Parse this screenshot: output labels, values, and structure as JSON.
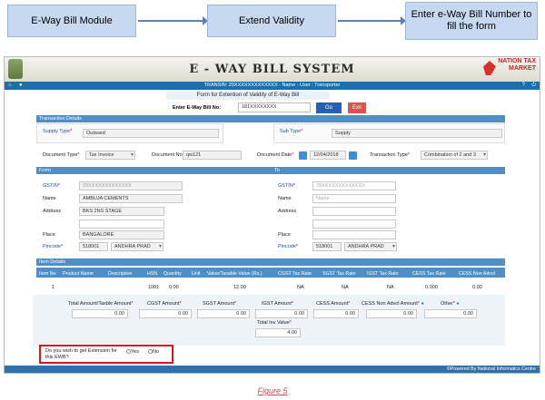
{
  "flow": {
    "step1": "E-Way Bill Module",
    "step2": "Extend Validity",
    "step3": "Enter e-Way Bill Number to fill the form"
  },
  "header": {
    "title": "E - WAY BILL SYSTEM",
    "logo_text": "NATION TAX MARKET",
    "nav_info": "TRANSIN: 29XXXXXXXXXXXXX - Name - User : Transporter"
  },
  "form": {
    "title": "Form for Extention of Validity of E-Way Bill",
    "ewb_label": "Enter E-Way Bill No:",
    "ewb_value": "181XXXXXXXX",
    "go": "Go",
    "exit": "Exit"
  },
  "transaction": {
    "section": "Transaction Details",
    "supply_type_label": "Supply Type",
    "supply_type": "Outward",
    "sub_type_label": "Sub Type",
    "sub_type": "Supply",
    "doc_type_label": "Document Type",
    "doc_type": "Tax Invoice",
    "doc_no_label": "Document No",
    "doc_no": "qw121",
    "doc_date_label": "Document Date",
    "doc_date": "12/04/2018",
    "txn_type_label": "Transaction Type",
    "txn_type": "Combination of 2 and 3"
  },
  "from": {
    "section": "From",
    "gstin_label": "GSTIN",
    "gstin": "29XXXXXXXXXXXXX",
    "name_label": "Name",
    "name": "AMBUJA CEMENTS",
    "address_label": "Address",
    "address1": "BKS 2NS STAGE",
    "address2": "",
    "place_label": "Place",
    "place": "BANGALORE",
    "pincode_label": "Pincode",
    "pincode": "518001",
    "state": "ANDHRA PRAD"
  },
  "to": {
    "section": "To",
    "gstin_label": "GSTIN",
    "gstin": "29XXXXXXXXXXXXX",
    "name_label": "Name",
    "name": "Name",
    "address_label": "Address",
    "place_label": "Place",
    "pincode_label": "Pincode",
    "pincode": "518001",
    "state": "ANDHRA PRAD"
  },
  "items": {
    "section": "Item Details",
    "headers": [
      "Item No",
      "Product Name",
      "Description",
      "HSN",
      "Quantity",
      "Unit",
      "Value/Taxable Value (Rs.)",
      "CGST Tax Rate",
      "SGST Tax Rate",
      "IGST Tax Rate",
      "CESS Tax Rate",
      "CESS Non Advol"
    ],
    "row": [
      "1",
      "",
      "",
      "1001",
      "0.00",
      "",
      "12.00",
      "NA",
      "NA",
      "NA",
      "0.000",
      "0.00"
    ]
  },
  "totals": {
    "total_amount_label": "Total Amount/Taxble Amount",
    "total_amount": "0.00",
    "cgst_label": "CGST Amount",
    "cgst": "0.00",
    "sgst_label": "SGST Amount",
    "sgst": "0.00",
    "igst_label": "IGST Amount",
    "igst": "0.00",
    "cess_label": "CESS Amount",
    "cess": "0.00",
    "cess_nonadvol_label": "CESS Non Advol Amount",
    "cess_nonadvol": "0.00",
    "other_label": "Other",
    "other": "0.00",
    "total_inv_label": "Total Inv Value",
    "total_inv": "4.00"
  },
  "extension": {
    "question": "Do you wish to get Extension for this EWB?",
    "yes": "Yes",
    "no": "No"
  },
  "footer": {
    "powered": "©Powered By National Informatics Centre"
  },
  "caption": "Figure 5",
  "colors": {
    "step_fill": "#c6d9f1",
    "nav_blue": "#1e6fa8",
    "section_blue": "#4f8fc6",
    "go_button": "#2a5fad",
    "exit_button": "#d9534f",
    "highlight_red": "#d8151b"
  }
}
